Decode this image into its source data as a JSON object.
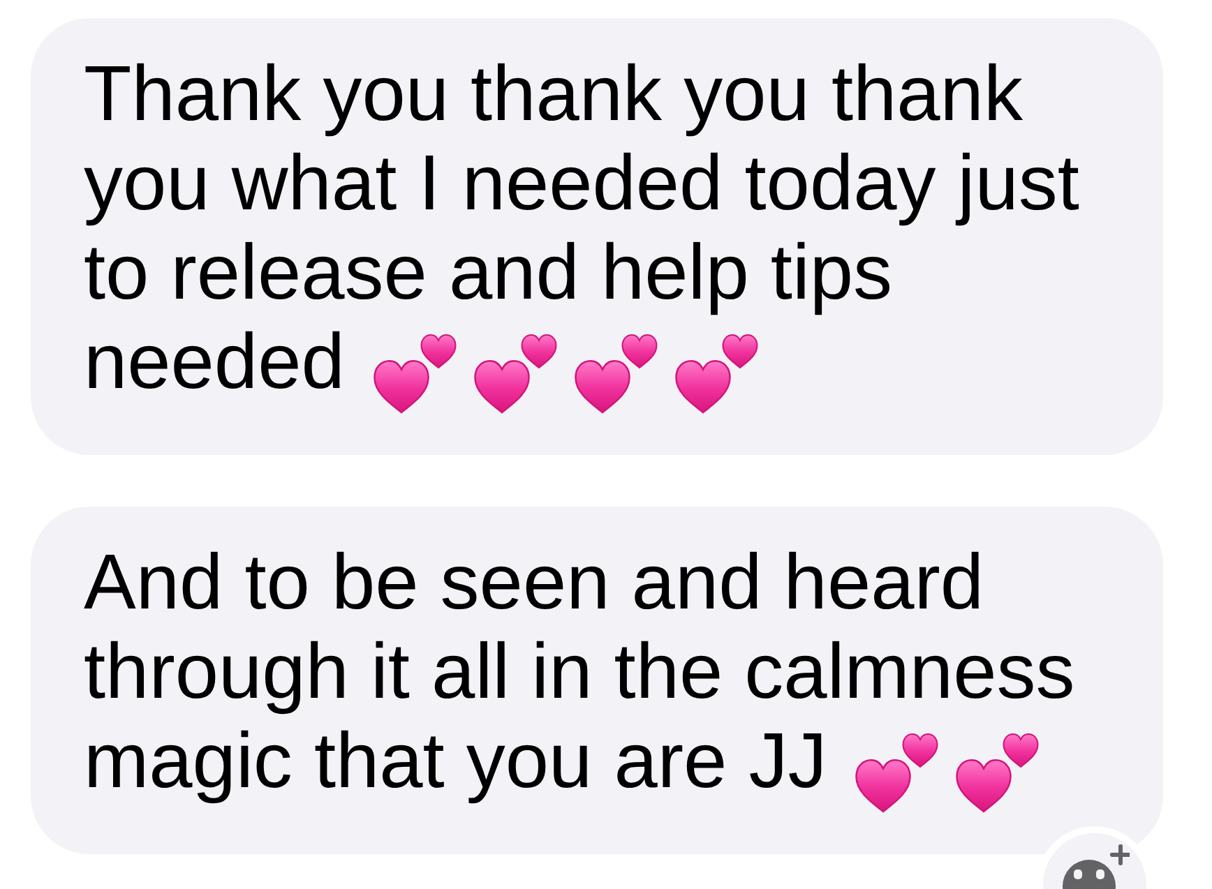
{
  "messages": [
    {
      "lines": [
        "Thank you thank you thank",
        "you what I needed today just",
        "to release and help tips",
        "needed"
      ],
      "emojis": [
        {
          "kind": "two_hearts"
        },
        {
          "kind": "two_hearts"
        },
        {
          "kind": "two_hearts"
        },
        {
          "kind": "two_hearts"
        }
      ]
    },
    {
      "lines": [
        "And to be seen and heard",
        "through it all in the calmness",
        "magic that you are JJ"
      ],
      "emojis": [
        {
          "kind": "two_hearts"
        },
        {
          "kind": "two_hearts"
        }
      ]
    }
  ]
}
